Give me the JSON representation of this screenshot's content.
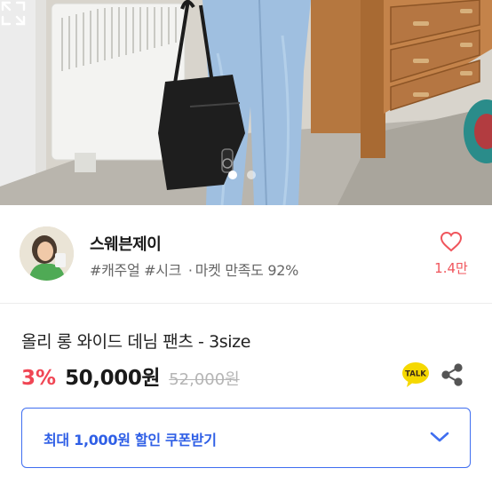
{
  "product_image": {
    "pagination": {
      "total": 2,
      "active": 1
    }
  },
  "seller": {
    "name": "스웨븐제이",
    "tags": [
      "#캐주얼",
      "#시크"
    ],
    "separator": "·",
    "satisfaction": "마켓 만족도 92%"
  },
  "like": {
    "count": "1.4만"
  },
  "product": {
    "title": "올리 롱 와이드 데님 팬츠 - 3size",
    "discount": "3%",
    "price": "50,000원",
    "original_price": "52,000원"
  },
  "talk_badge": {
    "label": "TALK"
  },
  "coupon": {
    "label": "최대 1,000원 할인 쿠폰받기"
  },
  "colors": {
    "accent_blue": "#3f6ef0",
    "discount_red": "#f04654",
    "like_red": "#f0555c",
    "talk_yellow": "#f5d800"
  }
}
